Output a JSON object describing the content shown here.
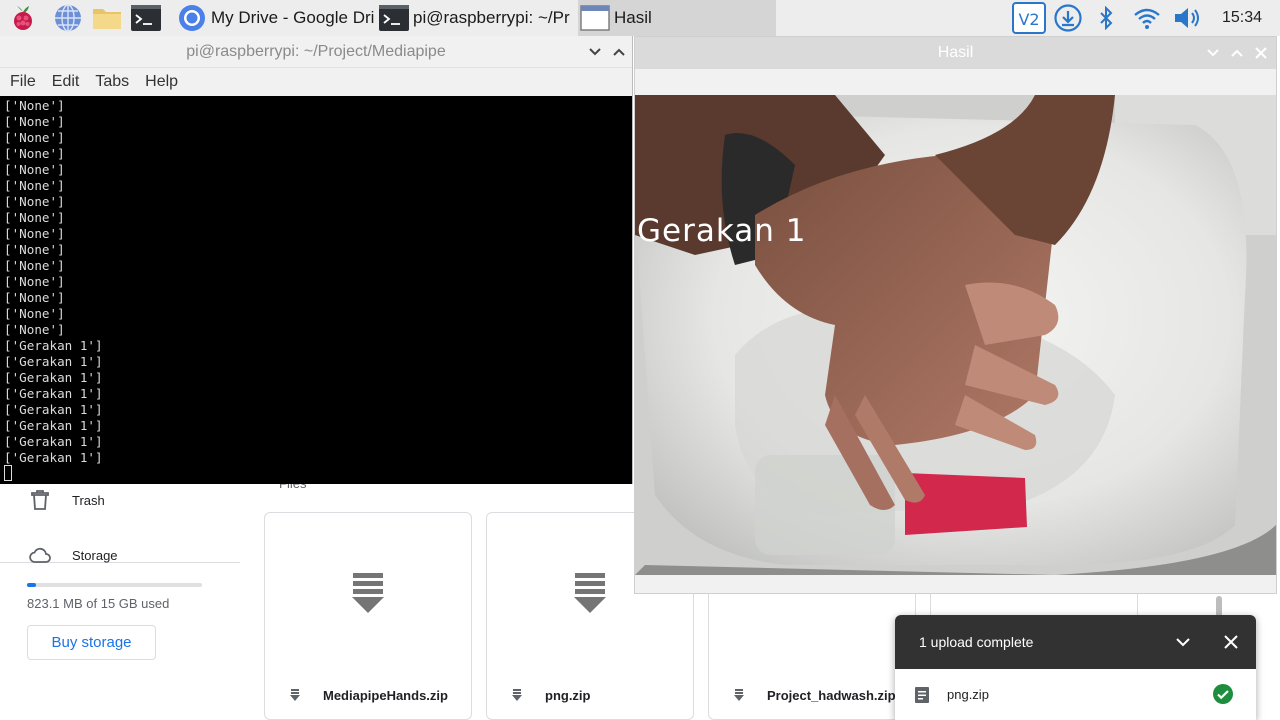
{
  "taskbar": {
    "tasks": [
      {
        "label": "My Drive - Google Dri"
      },
      {
        "label": "pi@raspberrypi: ~/Pr"
      },
      {
        "label": "Hasil"
      }
    ],
    "clock": "15:34"
  },
  "terminal": {
    "title": "pi@raspberrypi: ~/Project/Mediapipe",
    "menu": [
      "File",
      "Edit",
      "Tabs",
      "Help"
    ],
    "lines": [
      "['None']",
      "['None']",
      "['None']",
      "['None']",
      "['None']",
      "['None']",
      "['None']",
      "['None']",
      "['None']",
      "['None']",
      "['None']",
      "['None']",
      "['None']",
      "['None']",
      "['None']",
      "['Gerakan 1']",
      "['Gerakan 1']",
      "['Gerakan 1']",
      "['Gerakan 1']",
      "['Gerakan 1']",
      "['Gerakan 1']",
      "['Gerakan 1']",
      "['Gerakan 1']"
    ]
  },
  "hasil": {
    "title": "Hasil",
    "overlay_label": "Gerakan 1"
  },
  "drive": {
    "sidebar": {
      "trash_label": "Trash",
      "storage_label": "Storage",
      "storage_used_text": "823.1 MB of 15 GB used",
      "storage_used_fraction": 0.054,
      "buy_storage_label": "Buy storage"
    },
    "files_heading": "Files",
    "files": [
      {
        "name": "MediapipeHands.zip"
      },
      {
        "name": "png.zip"
      },
      {
        "name": "Project_hadwash.zip"
      }
    ]
  },
  "upload_toast": {
    "title": "1 upload complete",
    "file": "png.zip"
  },
  "colors": {
    "taskbar": "#ededed",
    "terminal_bg": "#000000",
    "drive_accent": "#1a73e8",
    "success": "#1e8e3e",
    "toast_header": "#323232"
  }
}
